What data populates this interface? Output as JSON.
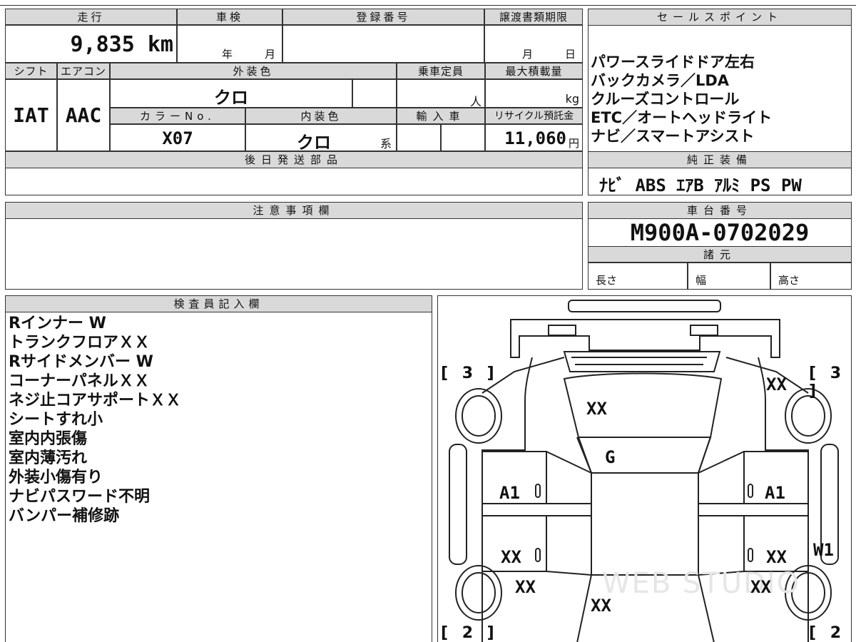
{
  "top": {
    "mileage": {
      "label": "走行",
      "value": "9,835 km"
    },
    "inspection": {
      "label": "車検",
      "year": "年",
      "month": "月"
    },
    "registration": {
      "label": "登録番号",
      "value": ""
    },
    "transfer_deadline": {
      "label": "譲渡書類期限",
      "month": "月",
      "day": "日"
    },
    "shift": {
      "label": "シフト",
      "value": "IAT"
    },
    "aircon": {
      "label": "エアコン",
      "value": "AAC"
    },
    "exterior_color": {
      "label": "外装色",
      "value": "クロ"
    },
    "capacity": {
      "label": "乗車定員",
      "unit": "人"
    },
    "max_load": {
      "label": "最大積載量",
      "unit": "kg"
    },
    "color_no": {
      "label": "カラーNo.",
      "value": "X07"
    },
    "interior_color": {
      "label": "内装色",
      "value": "クロ",
      "suffix": "系"
    },
    "import_car": {
      "label": "輸入車"
    },
    "recycle_fee": {
      "label": "リサイクル預託金",
      "value": "11,060",
      "unit": "円"
    },
    "later_parts": {
      "label": "後日発送部品"
    }
  },
  "sales_points": {
    "label": "セールスポイント",
    "lines": [
      "パワースライドドア左右",
      "バックカメラ／LDA",
      "クルーズコントロール",
      "ETC／オートヘッドライト",
      "ナビ／スマートアシスト"
    ]
  },
  "equipment": {
    "label": "純正装備",
    "value": "ﾅﾋﾞ ABS ｴｱB ｱﾙﾐ PS PW"
  },
  "notes": {
    "label": "注意事項欄"
  },
  "chassis": {
    "label": "車台番号",
    "value": "M900A-0702029"
  },
  "specs": {
    "label": "諸元",
    "length": "長さ",
    "width": "幅",
    "height": "高さ"
  },
  "inspector": {
    "label": "検査員記入欄",
    "lines": [
      "Rインナー W",
      "トランクフロアＸＸ",
      "Rサイドメンバー W",
      "コーナーパネルＸＸ",
      "ネジ止コアサポートＸＸ",
      "シートすれ小",
      "室内内張傷",
      "室内薄汚れ",
      "外装小傷有り",
      "ナビパスワード不明",
      "バンパー補修跡"
    ]
  },
  "diagram": {
    "tire_fl": "[ 3 ]",
    "tire_fr": "[ 3 ]",
    "tire_rl": "[ 2 ]",
    "tire_rr": "[ 2 ]",
    "marks": {
      "hood": "XX",
      "front_right": "XX",
      "windshield": "G",
      "left_front_door": "A1",
      "right_front_door": "A1",
      "left_rear_door": "XX",
      "right_rear_door": "XX",
      "left_rear_fender": "XX",
      "right_rear_fender": "XX",
      "right_side": "W1",
      "roof_rear": "XX",
      "zero_labels": "0"
    }
  },
  "watermark": "WEB STUDIO"
}
